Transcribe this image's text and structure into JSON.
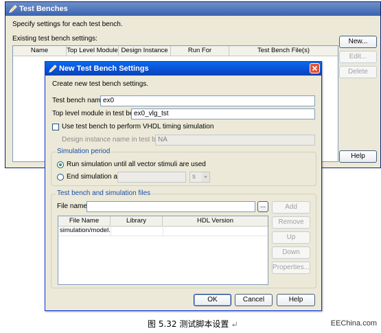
{
  "back_window": {
    "title": "Test Benches",
    "description": "Specify settings for each test bench.",
    "existing_label": "Existing test bench settings:",
    "columns": [
      "Name",
      "Top Level Module",
      "Design Instance",
      "Run For",
      "Test Bench File(s)"
    ],
    "buttons": {
      "new": "New...",
      "edit": "Edit...",
      "delete": "Delete",
      "help": "Help"
    }
  },
  "dialog": {
    "title": "New Test Bench Settings",
    "description": "Create new test bench settings.",
    "test_bench_name_label": "Test bench name:",
    "test_bench_name_value": "ex0",
    "top_level_label": "Top level module in test bench:",
    "top_level_value": "ex0_vlg_tst",
    "timing_sim_label": "Use test bench to perform VHDL timing simulation",
    "design_instance_label": "Design instance name in test bench:",
    "design_instance_value": "NA",
    "sim_period": {
      "title": "Simulation period",
      "run_all_label": "Run simulation until all vector stimuli are used",
      "end_sim_label": "End simulation at:",
      "end_sim_value": "",
      "unit": "s"
    },
    "files": {
      "title": "Test bench and simulation files",
      "file_name_label": "File name:",
      "file_name_value": "",
      "browse": "...",
      "columns": [
        "File Name",
        "Library",
        "HDL Version"
      ],
      "rows": [
        {
          "file": "simulation/model...",
          "library": "",
          "hdl": ""
        }
      ],
      "buttons": {
        "add": "Add",
        "remove": "Remove",
        "up": "Up",
        "down": "Down",
        "properties": "Properties..."
      }
    },
    "footer": {
      "ok": "OK",
      "cancel": "Cancel",
      "help": "Help"
    }
  },
  "caption": {
    "text": "图 5.32  测试脚本设置",
    "watermark": "EEChina.com"
  }
}
